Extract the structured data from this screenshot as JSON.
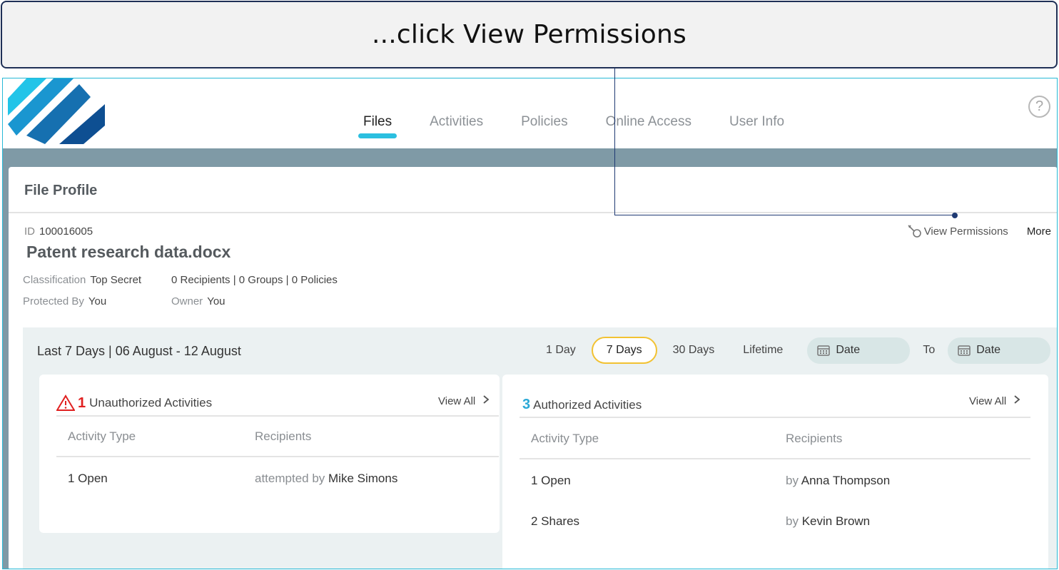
{
  "callout": {
    "text": "...click View Permissions"
  },
  "nav": {
    "items": [
      {
        "label": "Files",
        "active": true
      },
      {
        "label": "Activities",
        "active": false
      },
      {
        "label": "Policies",
        "active": false
      },
      {
        "label": "Online Access",
        "active": false
      },
      {
        "label": "User Info",
        "active": false
      }
    ],
    "help_glyph": "?"
  },
  "panel": {
    "title": "File Profile",
    "id_label": "ID",
    "id_value": "100016005",
    "file_name": "Patent research data.docx",
    "classification_label": "Classification",
    "classification_value": "Top Secret",
    "protected_by_label": "Protected By",
    "protected_by_value": "You",
    "summary": "0 Recipients | 0 Groups | 0 Policies",
    "owner_label": "Owner",
    "owner_value": "You",
    "view_permissions_label": "View Permissions",
    "more_label": "More"
  },
  "activity": {
    "range_text": "Last 7 Days | 06 August - 12 August",
    "filters": [
      "1 Day",
      "7 Days",
      "30 Days",
      "Lifetime"
    ],
    "selected_filter": "7 Days",
    "date_from_placeholder": "Date",
    "to_label": "To",
    "date_to_placeholder": "Date",
    "unauthorized": {
      "count": "1",
      "title": "Unauthorized Activities",
      "view_all": "View All",
      "col_type": "Activity Type",
      "col_recipients": "Recipients",
      "rows": [
        {
          "type": "1 Open",
          "prefix": "attempted by",
          "name": "Mike Simons"
        }
      ]
    },
    "authorized": {
      "count": "3",
      "title": "Authorized Activities",
      "view_all": "View All",
      "col_type": "Activity Type",
      "col_recipients": "Recipients",
      "rows": [
        {
          "type": "1 Open",
          "prefix": "by",
          "name": "Anna Thompson"
        },
        {
          "type": "2 Shares",
          "prefix": "by",
          "name": "Kevin Brown"
        }
      ]
    }
  },
  "colors": {
    "accent": "#2bbfe0",
    "selected_filter_border": "#f2c232",
    "warning": "#e02020",
    "authorized_count": "#2aa8d6",
    "header_band": "#7f9aa6"
  },
  "icons": {
    "logo": "logo-stripes-icon",
    "help": "help-circle-icon",
    "view_permissions": "key-icon",
    "calendar": "calendar-icon",
    "warning": "warning-triangle-icon",
    "chevron": "chevron-right-icon"
  }
}
